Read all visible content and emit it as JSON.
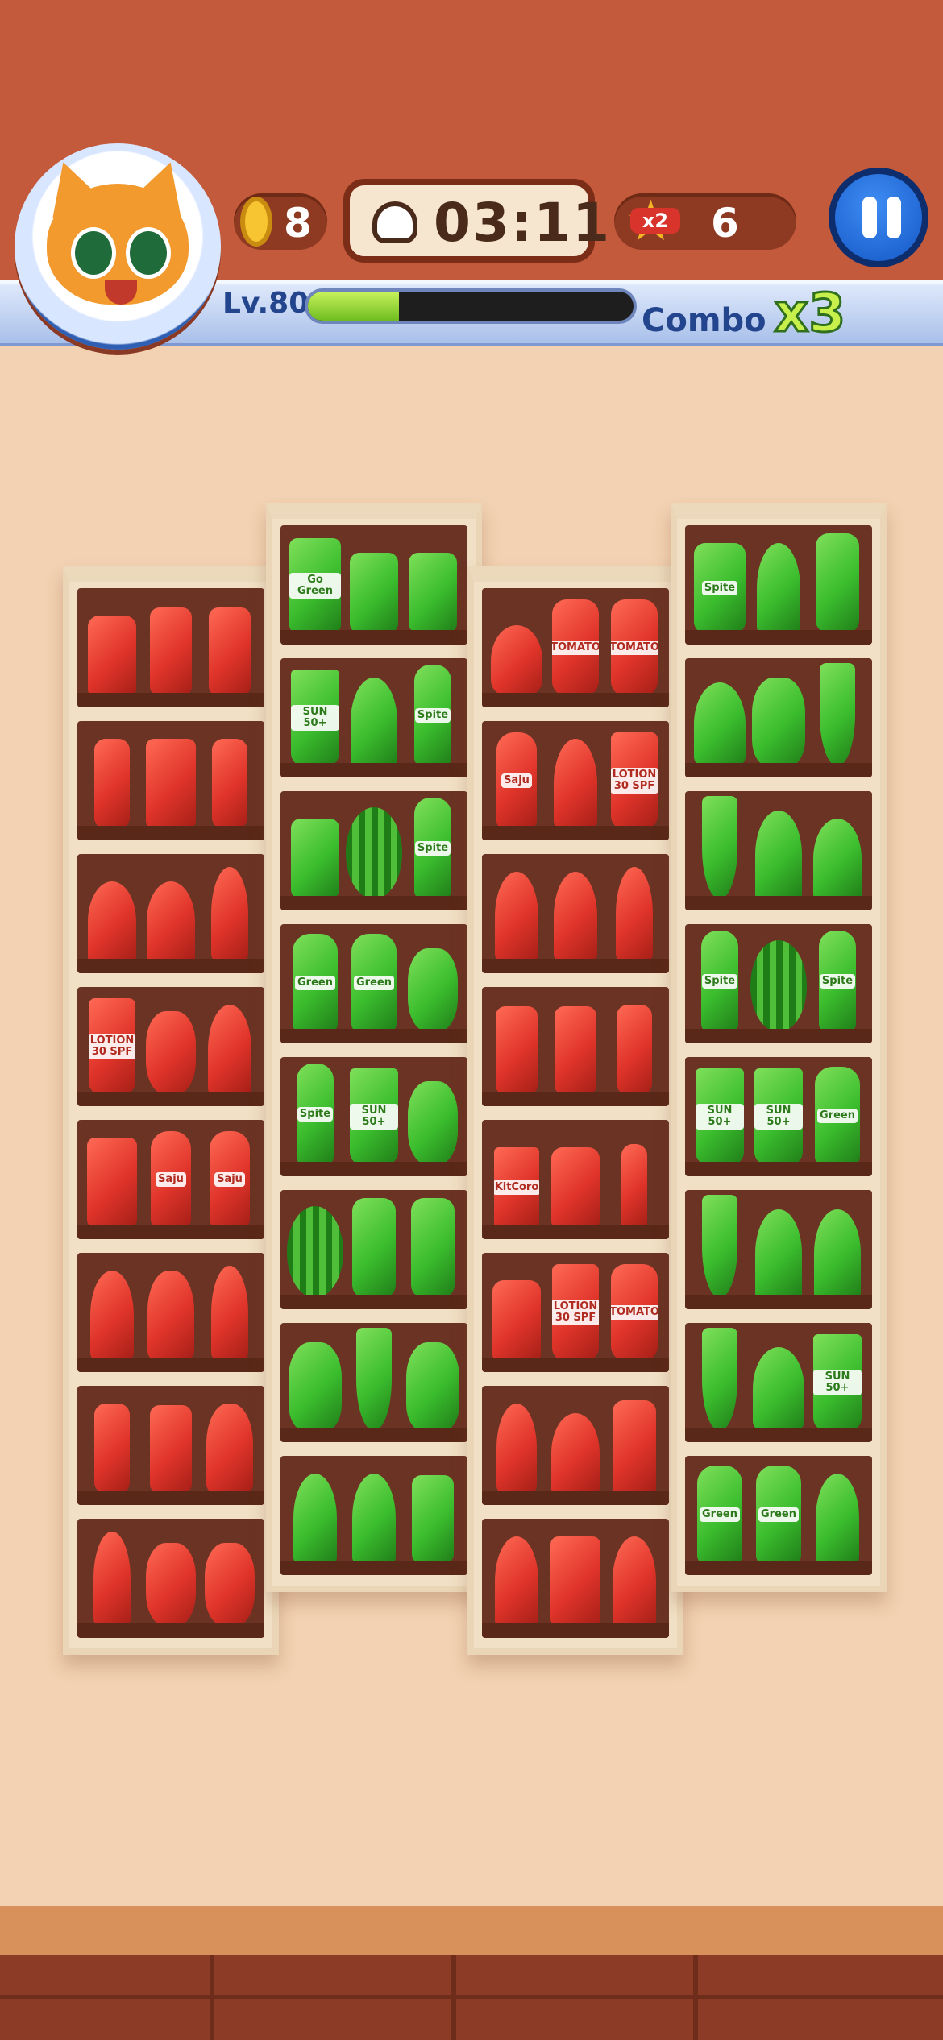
{
  "hud": {
    "coins": "8",
    "timer": "03:11",
    "star_multiplier": "x2",
    "stars": "6",
    "level": "Lv.80",
    "level_progress": 0.28,
    "combo_label": "Combo",
    "combo_value": "x3"
  },
  "colors": {
    "red": "#e0342a",
    "green": "#3bbd2e",
    "wood": "#6b3323"
  },
  "shelves": [
    {
      "rows": [
        [
          {
            "name": "red-gift-bag-icon",
            "c": "red"
          },
          {
            "name": "red-walkie-talkie-icon",
            "c": "red"
          },
          {
            "name": "red-walkie-talkie-icon",
            "c": "red"
          }
        ],
        [
          {
            "name": "red-thermos-icon",
            "c": "red"
          },
          {
            "name": "red-game-console-icon",
            "c": "red"
          },
          {
            "name": "red-thermos-icon",
            "c": "red"
          }
        ],
        [
          {
            "name": "red-desk-lamp-icon",
            "c": "red"
          },
          {
            "name": "red-desk-lamp-icon",
            "c": "red"
          },
          {
            "name": "red-hairbrush-icon",
            "c": "red"
          }
        ],
        [
          {
            "name": "red-lotion-tube-icon",
            "c": "red",
            "text": "LOTION 30 SPF"
          },
          {
            "name": "red-macaron-stack-icon",
            "c": "red"
          },
          {
            "name": "red-hand-mirror-icon",
            "c": "red"
          }
        ],
        [
          {
            "name": "red-game-console-icon",
            "c": "red"
          },
          {
            "name": "red-soju-bottle-icon",
            "c": "red",
            "text": "Saju"
          },
          {
            "name": "red-soju-bottle-icon",
            "c": "red",
            "text": "Saju"
          }
        ],
        [
          {
            "name": "red-rocket-icon",
            "c": "red"
          },
          {
            "name": "red-astronaut-icon",
            "c": "red"
          },
          {
            "name": "red-hairbrush-icon",
            "c": "red"
          }
        ],
        [
          {
            "name": "red-thermos-icon",
            "c": "red"
          },
          {
            "name": "red-walkie-talkie-icon",
            "c": "red"
          },
          {
            "name": "red-astronaut-icon",
            "c": "red"
          }
        ],
        [
          {
            "name": "red-hairbrush-icon",
            "c": "red"
          },
          {
            "name": "red-macaron-stack-icon",
            "c": "red"
          },
          {
            "name": "red-macaron-stack-icon",
            "c": "red"
          }
        ]
      ]
    },
    {
      "rows": [
        [
          {
            "name": "green-juice-box-icon",
            "c": "green",
            "text": "Go Green"
          },
          {
            "name": "green-dumbbell-icon",
            "c": "green"
          },
          {
            "name": "green-dumbbell-icon",
            "c": "green"
          }
        ],
        [
          {
            "name": "green-sunscreen-icon",
            "c": "green",
            "text": "SUN 50+"
          },
          {
            "name": "green-tree-icon",
            "c": "green"
          },
          {
            "name": "green-soda-bottle-icon",
            "c": "green",
            "text": "Spite"
          }
        ],
        [
          {
            "name": "green-dumbbell-icon",
            "c": "green"
          },
          {
            "name": "green-watermelon-icon",
            "c": "green"
          },
          {
            "name": "green-soda-bottle-icon",
            "c": "green",
            "text": "Spite"
          }
        ],
        [
          {
            "name": "green-bottle-icon",
            "c": "green",
            "text": "Green"
          },
          {
            "name": "green-bottle-icon",
            "c": "green",
            "text": "Green"
          },
          {
            "name": "green-macaron-stack-icon",
            "c": "green"
          }
        ],
        [
          {
            "name": "green-soda-bottle-icon",
            "c": "green",
            "text": "Spite"
          },
          {
            "name": "green-sunscreen-icon",
            "c": "green",
            "text": "SUN 50+"
          },
          {
            "name": "green-macaron-stack-icon",
            "c": "green"
          }
        ],
        [
          {
            "name": "green-watermelon-icon",
            "c": "green"
          },
          {
            "name": "green-sippy-bottle-icon",
            "c": "green"
          },
          {
            "name": "green-sippy-bottle-icon",
            "c": "green"
          }
        ],
        [
          {
            "name": "green-vase-icon",
            "c": "green"
          },
          {
            "name": "green-pencil-icon",
            "c": "green"
          },
          {
            "name": "green-vase-icon",
            "c": "green"
          }
        ],
        [
          {
            "name": "green-hand-mirror-icon",
            "c": "green"
          },
          {
            "name": "green-hand-mirror-icon",
            "c": "green"
          },
          {
            "name": "green-walkie-talkie-icon",
            "c": "green"
          }
        ]
      ]
    },
    {
      "rows": [
        [
          {
            "name": "red-ufo-icon",
            "c": "red"
          },
          {
            "name": "red-ketchup-bottle-icon",
            "c": "red",
            "text": "TOMATO"
          },
          {
            "name": "red-ketchup-bottle-icon",
            "c": "red",
            "text": "TOMATO"
          }
        ],
        [
          {
            "name": "red-soju-bottle-icon",
            "c": "red",
            "text": "Saju"
          },
          {
            "name": "red-rocket-icon",
            "c": "red"
          },
          {
            "name": "red-lotion-tube-icon",
            "c": "red",
            "text": "LOTION 30 SPF"
          }
        ],
        [
          {
            "name": "red-rocket-icon",
            "c": "red"
          },
          {
            "name": "red-rocket-icon",
            "c": "red"
          },
          {
            "name": "red-hairbrush-icon",
            "c": "red"
          }
        ],
        [
          {
            "name": "red-walkie-talkie-icon",
            "c": "red"
          },
          {
            "name": "red-walkie-talkie-icon",
            "c": "red"
          },
          {
            "name": "red-thermos-icon",
            "c": "red"
          }
        ],
        [
          {
            "name": "red-chocolate-bar-icon",
            "c": "red",
            "text": "KitCoro"
          },
          {
            "name": "red-gift-bag-icon",
            "c": "red"
          },
          {
            "name": "red-lipstick-icon",
            "c": "red"
          }
        ],
        [
          {
            "name": "red-gift-bag-icon",
            "c": "red"
          },
          {
            "name": "red-lotion-tube-icon",
            "c": "red",
            "text": "LOTION 30 SPF"
          },
          {
            "name": "red-ketchup-bottle-icon",
            "c": "red",
            "text": "TOMATO"
          }
        ],
        [
          {
            "name": "red-popsicle-icon",
            "c": "red"
          },
          {
            "name": "red-desk-lamp-icon",
            "c": "red"
          },
          {
            "name": "red-blender-icon",
            "c": "red"
          }
        ],
        [
          {
            "name": "red-hand-mirror-icon",
            "c": "red"
          },
          {
            "name": "red-game-console-icon",
            "c": "red"
          },
          {
            "name": "red-hand-mirror-icon",
            "c": "red"
          }
        ]
      ]
    },
    {
      "rows": [
        [
          {
            "name": "green-soda-can-icon",
            "c": "green",
            "text": "Spite"
          },
          {
            "name": "green-hand-mirror-icon",
            "c": "green"
          },
          {
            "name": "green-sippy-bottle-icon",
            "c": "green"
          }
        ],
        [
          {
            "name": "green-cupcake-icon",
            "c": "green"
          },
          {
            "name": "green-vase-icon",
            "c": "green"
          },
          {
            "name": "green-pencil-icon",
            "c": "green"
          }
        ],
        [
          {
            "name": "green-pencil-icon",
            "c": "green"
          },
          {
            "name": "green-tree-icon",
            "c": "green"
          },
          {
            "name": "green-desk-lamp-icon",
            "c": "green"
          }
        ],
        [
          {
            "name": "green-soda-bottle-icon",
            "c": "green",
            "text": "Spite"
          },
          {
            "name": "green-watermelon-icon",
            "c": "green"
          },
          {
            "name": "green-soda-bottle-icon",
            "c": "green",
            "text": "Spite"
          }
        ],
        [
          {
            "name": "green-sunscreen-icon",
            "c": "green",
            "text": "SUN 50+"
          },
          {
            "name": "green-sunscreen-icon",
            "c": "green",
            "text": "SUN 50+"
          },
          {
            "name": "green-bottle-icon",
            "c": "green",
            "text": "Green"
          }
        ],
        [
          {
            "name": "green-pencil-icon",
            "c": "green"
          },
          {
            "name": "green-tree-icon",
            "c": "green"
          },
          {
            "name": "green-tree-icon",
            "c": "green"
          }
        ],
        [
          {
            "name": "green-pencil-icon",
            "c": "green"
          },
          {
            "name": "green-cupcake-icon",
            "c": "green"
          },
          {
            "name": "green-sunscreen-icon",
            "c": "green",
            "text": "SUN 50+"
          }
        ],
        [
          {
            "name": "green-bottle-icon",
            "c": "green",
            "text": "Green"
          },
          {
            "name": "green-bottle-icon",
            "c": "green",
            "text": "Green"
          },
          {
            "name": "green-hand-mirror-icon",
            "c": "green"
          }
        ]
      ]
    }
  ]
}
